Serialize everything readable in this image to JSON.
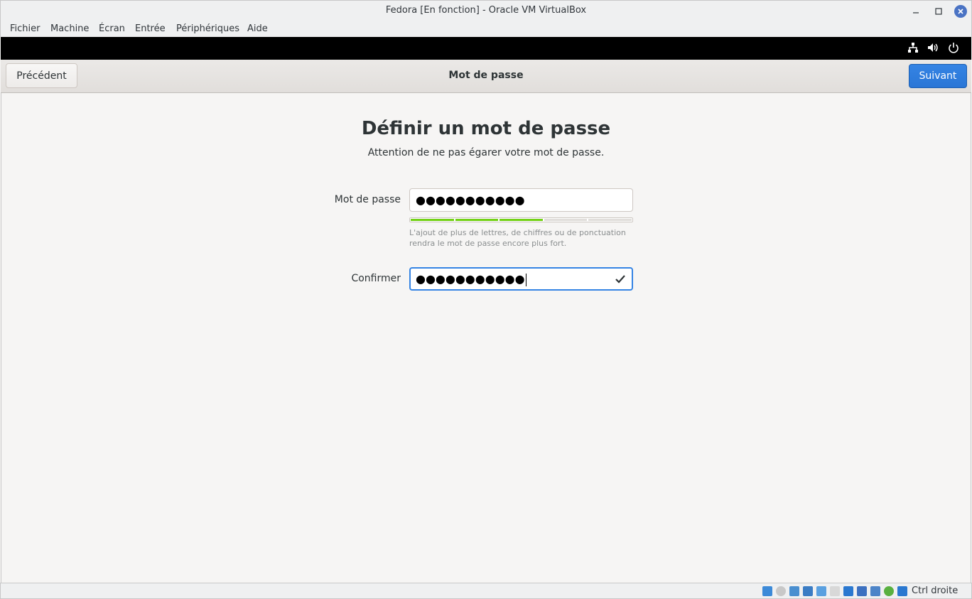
{
  "window": {
    "title": "Fedora [En fonction] - Oracle VM VirtualBox"
  },
  "menubar": {
    "items": [
      "Fichier",
      "Machine",
      "Écran",
      "Entrée",
      "Périphériques",
      "Aide"
    ]
  },
  "gnome_top": {
    "icons": [
      "network-icon",
      "volume-icon",
      "power-icon"
    ]
  },
  "header": {
    "prev_label": "Précédent",
    "title": "Mot de passe",
    "next_label": "Suivant"
  },
  "page": {
    "heading": "Définir un mot de passe",
    "subtitle": "Attention de ne pas égarer votre mot de passe."
  },
  "form": {
    "password_label": "Mot de passe",
    "password_value": "●●●●●●●●●●●",
    "strength_level": 0.6,
    "hint": "L'ajout de plus de lettres, de chiffres ou de ponctuation rendra le mot de passe encore plus fort.",
    "confirm_label": "Confirmer",
    "confirm_value": "●●●●●●●●●●●"
  },
  "statusbar": {
    "host_key": "Ctrl droite",
    "icons": [
      "hard-disk-icon",
      "optical-drive-icon",
      "audio-icon",
      "network-icon",
      "usb-icon",
      "shared-folders-icon",
      "display-icon",
      "video-capture-icon",
      "recording-icon",
      "guest-additions-icon",
      "keyboard-capture-icon",
      "mouse-integration-icon"
    ]
  },
  "colors": {
    "accent": "#3584e4",
    "strength": "#73d216",
    "close": "#4a73c4"
  }
}
